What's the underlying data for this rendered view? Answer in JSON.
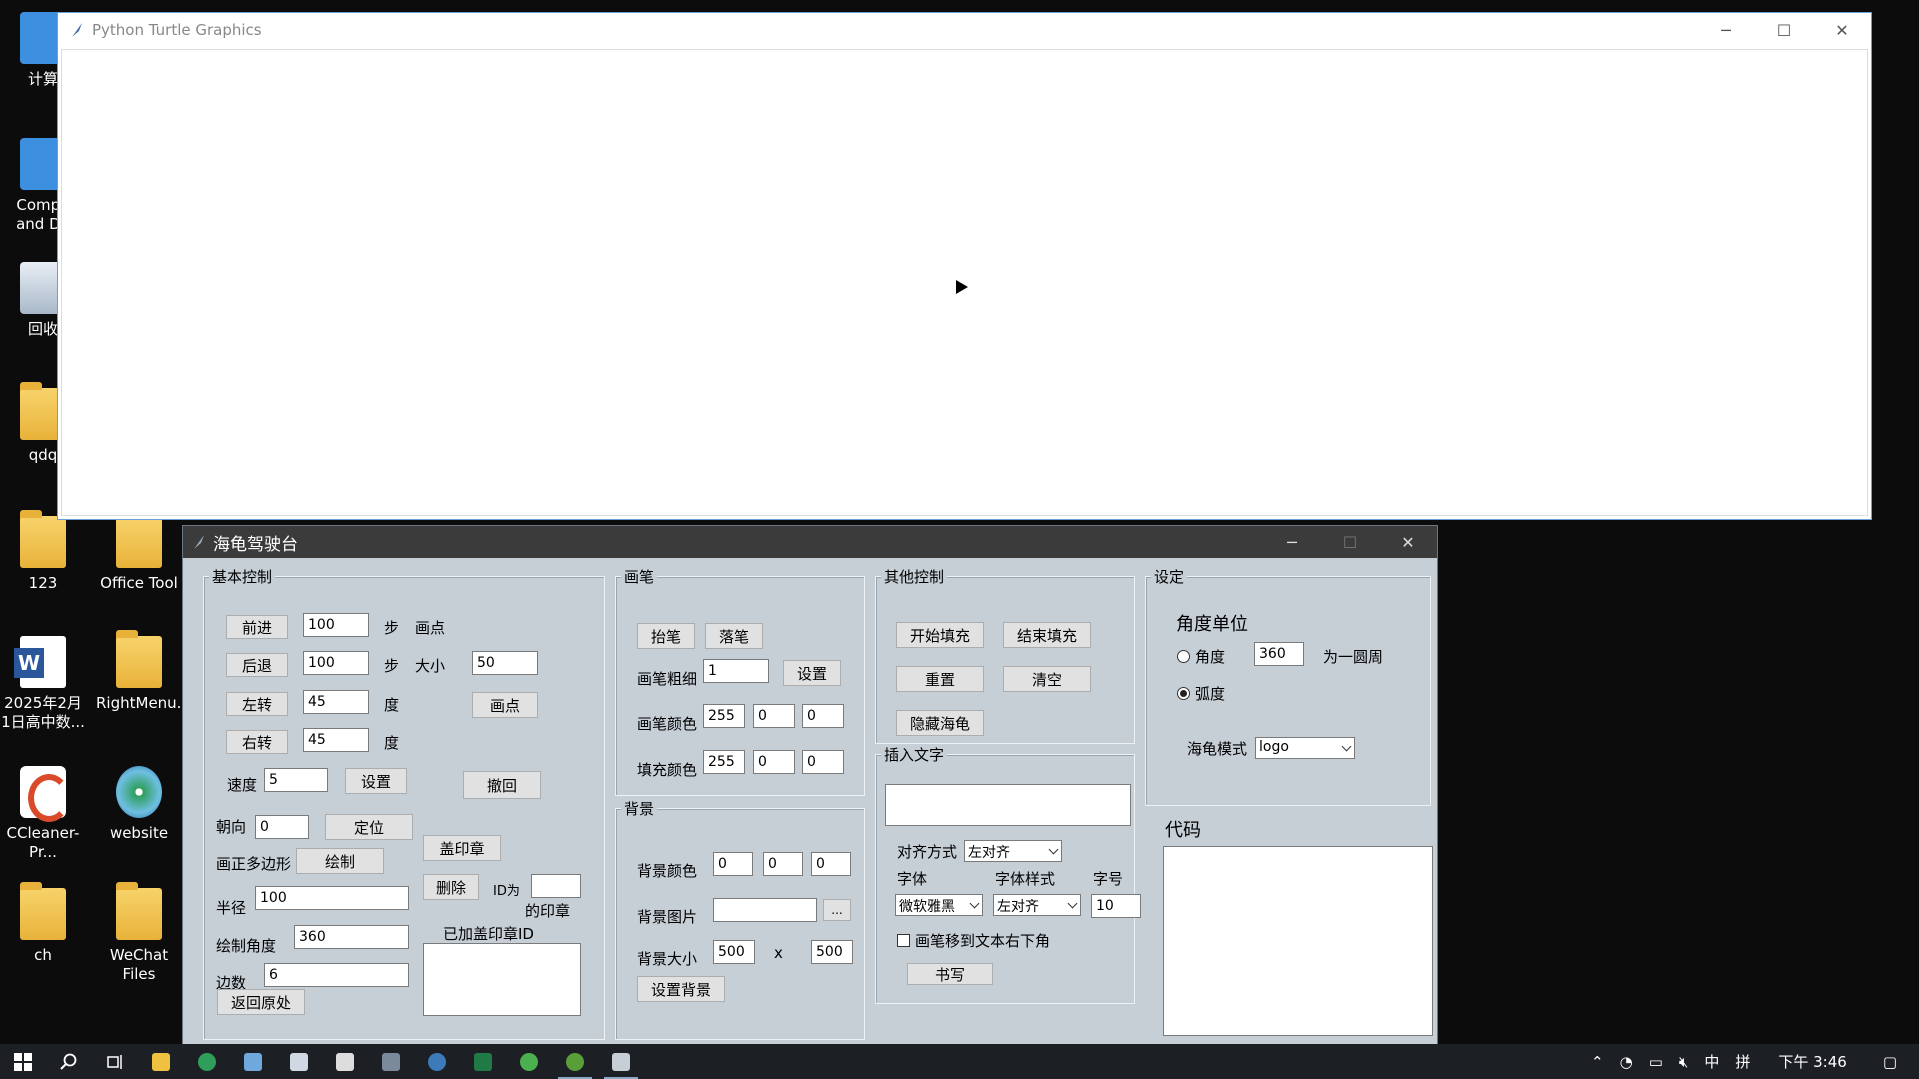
{
  "desktop": {
    "icons": [
      {
        "label": "计算",
        "kind": "monitor"
      },
      {
        "label": "Compu and De",
        "kind": "monitor"
      },
      {
        "label": "回收",
        "kind": "bin"
      },
      {
        "label": "qdq",
        "kind": "folder"
      },
      {
        "label": "123",
        "kind": "folder"
      },
      {
        "label": "Office Tool",
        "kind": "folder"
      },
      {
        "label": "2025年2月1日高中数...",
        "kind": "doc"
      },
      {
        "label": "RightMenu...",
        "kind": "folder"
      },
      {
        "label": "CCleaner-Pr...",
        "kind": "cc"
      },
      {
        "label": "website",
        "kind": "cd"
      },
      {
        "label": "ch",
        "kind": "folder"
      },
      {
        "label": "WeChat Files",
        "kind": "folder"
      }
    ]
  },
  "turtle_window": {
    "title": "Python Turtle Graphics"
  },
  "panel": {
    "title": "海龟驾驶台",
    "basic": {
      "label": "基本控制",
      "forward_btn": "前进",
      "forward_val": "100",
      "forward_unit": "步",
      "back_btn": "后退",
      "back_val": "100",
      "back_unit": "步",
      "left_btn": "左转",
      "left_val": "45",
      "left_unit": "度",
      "right_btn": "右转",
      "right_val": "45",
      "right_unit": "度",
      "speed_label": "速度",
      "speed_val": "5",
      "speed_set_btn": "设置",
      "dot_label": "画点",
      "size_label": "大小",
      "size_val": "50",
      "dot_btn": "画点",
      "undo_btn": "撤回",
      "heading_label": "朝向",
      "heading_val": "0",
      "locate_btn": "定位",
      "polygon_label": "画正多边形",
      "draw_btn": "绘制",
      "stamp_btn": "盖印章",
      "delete_btn": "删除",
      "id_label": "ID为",
      "id_val": "",
      "stamp_suffix": "的印章",
      "radius_label": "半径",
      "radius_val": "100",
      "angle_label": "绘制角度",
      "angle_val": "360",
      "sides_label": "边数",
      "sides_val": "6",
      "stamped_label": "已加盖印章ID",
      "home_btn": "返回原处"
    },
    "pen": {
      "label": "画笔",
      "up_btn": "抬笔",
      "down_btn": "落笔",
      "width_label": "画笔粗细",
      "width_val": "1",
      "width_set_btn": "设置",
      "pen_color_label": "画笔颜色",
      "pen_r": "255",
      "pen_g": "0",
      "pen_b": "0",
      "fill_color_label": "填充颜色",
      "fill_r": "255",
      "fill_g": "0",
      "fill_b": "0"
    },
    "background": {
      "label": "背景",
      "color_label": "背景颜色",
      "r": "0",
      "g": "0",
      "b": "0",
      "image_label": "背景图片",
      "image_val": "",
      "browse_btn": "...",
      "size_label": "背景大小",
      "width_val": "500",
      "x_label": "x",
      "height_val": "500",
      "set_btn": "设置背景"
    },
    "other": {
      "label": "其他控制",
      "begin_fill_btn": "开始填充",
      "end_fill_btn": "结束填充",
      "reset_btn": "重置",
      "clear_btn": "清空",
      "hide_btn": "隐藏海龟"
    },
    "text": {
      "label": "插入文字",
      "text_val": "",
      "align_label": "对齐方式",
      "align_val": "左对齐",
      "font_label": "字体",
      "font_val": "微软雅黑",
      "style_label": "字体样式",
      "style_val": "左对齐",
      "fontsize_label": "字号",
      "fontsize_val": "10",
      "move_label": "画笔移到文本右下角",
      "write_btn": "书写"
    },
    "settings": {
      "label": "设定",
      "unit_label": "角度单位",
      "degree_label": "角度",
      "degree_val": "360",
      "circle_label": "为一圆周",
      "radian_label": "弧度",
      "mode_label": "海龟模式",
      "mode_val": "logo"
    },
    "code": {
      "label": "代码",
      "content": ""
    }
  },
  "taskbar": {
    "ime": "中",
    "layout": "拼",
    "time": "下午 3:46"
  }
}
